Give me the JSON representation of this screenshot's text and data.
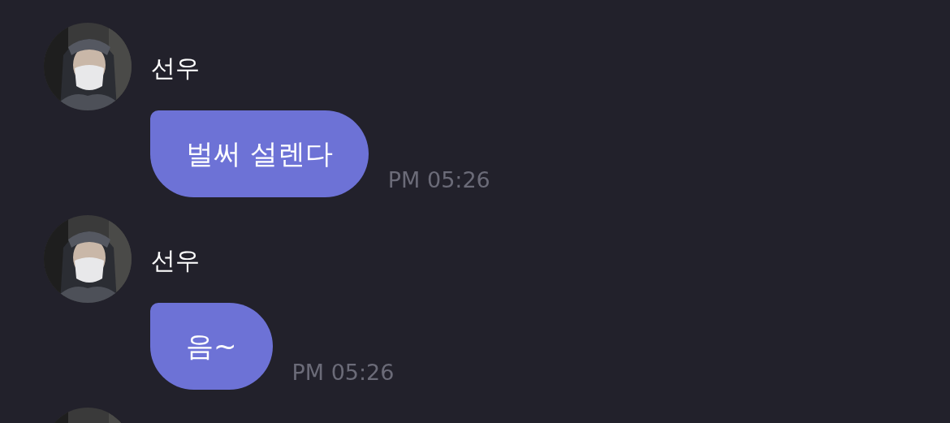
{
  "messages": [
    {
      "kind": "message",
      "sender": "선우",
      "text": "벌써 설렌다",
      "time": "PM 05:26"
    },
    {
      "kind": "message",
      "sender": "선우",
      "text": "음~",
      "time": "PM 05:26"
    },
    {
      "kind": "avatar"
    }
  ]
}
